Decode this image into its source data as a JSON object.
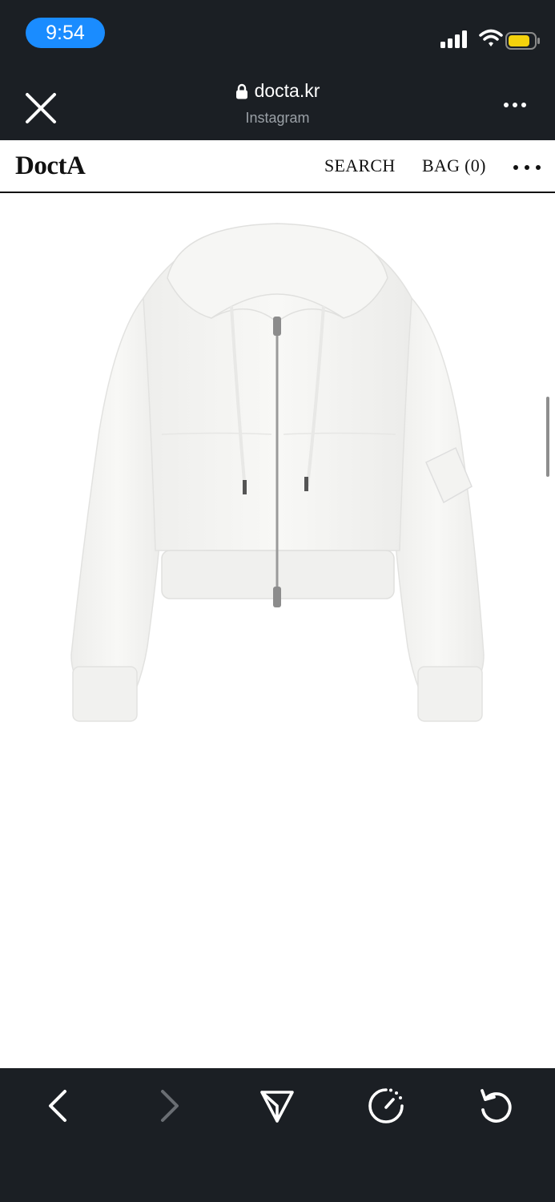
{
  "status_bar": {
    "time": "9:54",
    "icons": [
      "signal-icon",
      "wifi-icon",
      "battery-icon"
    ]
  },
  "browser": {
    "url": "docta.kr",
    "subtitle": "Instagram",
    "icons": [
      "close-icon",
      "lock-icon",
      "more-icon"
    ]
  },
  "site": {
    "logo": "DoctA",
    "search_label": "SEARCH",
    "bag_label": "BAG (0)"
  },
  "product": {
    "image": "white cropped zip-up hoodie"
  },
  "toolbar": {
    "icons": [
      "back-icon",
      "forward-icon",
      "share-icon",
      "speed-icon",
      "reload-icon"
    ]
  },
  "colors": {
    "chrome_bg": "#1b1f24",
    "time_pill": "#1a8cff",
    "battery": "#f5d20c",
    "page_bg": "#ffffff"
  }
}
